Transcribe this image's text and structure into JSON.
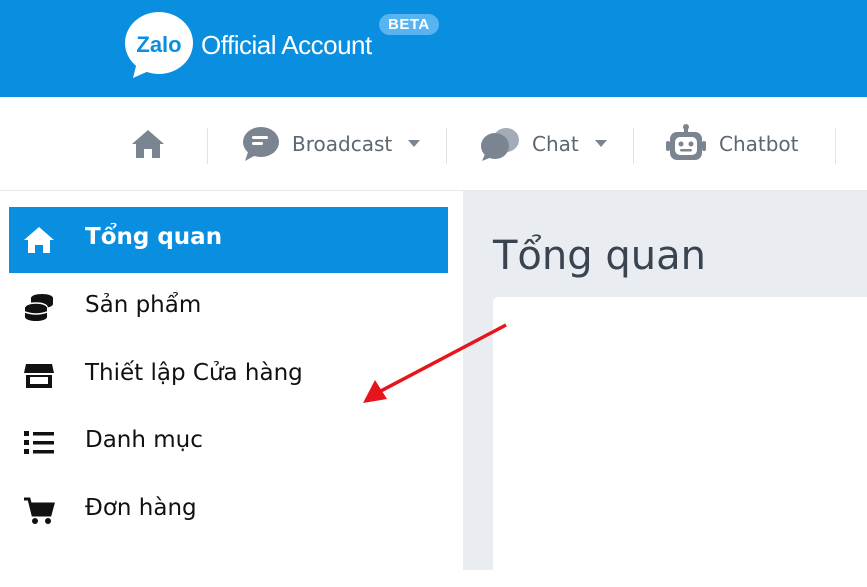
{
  "brand": {
    "logo_word": "Zalo",
    "name": "Official Account",
    "badge": "BETA"
  },
  "nav": {
    "items": [
      {
        "label": "",
        "icon": "home-icon"
      },
      {
        "label": "Broadcast",
        "icon": "broadcast-icon",
        "dropdown": true
      },
      {
        "label": "Chat",
        "icon": "chat-icon",
        "dropdown": true
      },
      {
        "label": "Chatbot",
        "icon": "chatbot-icon"
      }
    ]
  },
  "sidebar": {
    "items": [
      {
        "label": "Tổng quan",
        "icon": "home-icon",
        "active": true
      },
      {
        "label": "Sản phẩm",
        "icon": "coins-icon"
      },
      {
        "label": "Thiết lập Cửa hàng",
        "icon": "store-icon"
      },
      {
        "label": "Danh mục",
        "icon": "list-icon"
      },
      {
        "label": "Đơn hàng",
        "icon": "cart-icon"
      }
    ]
  },
  "main": {
    "title": "Tổng quan"
  },
  "colors": {
    "brand_blue": "#0a8fe0",
    "nav_text": "#5c6773",
    "content_bg": "#e9edf1",
    "annotation_red": "#e8141b"
  }
}
